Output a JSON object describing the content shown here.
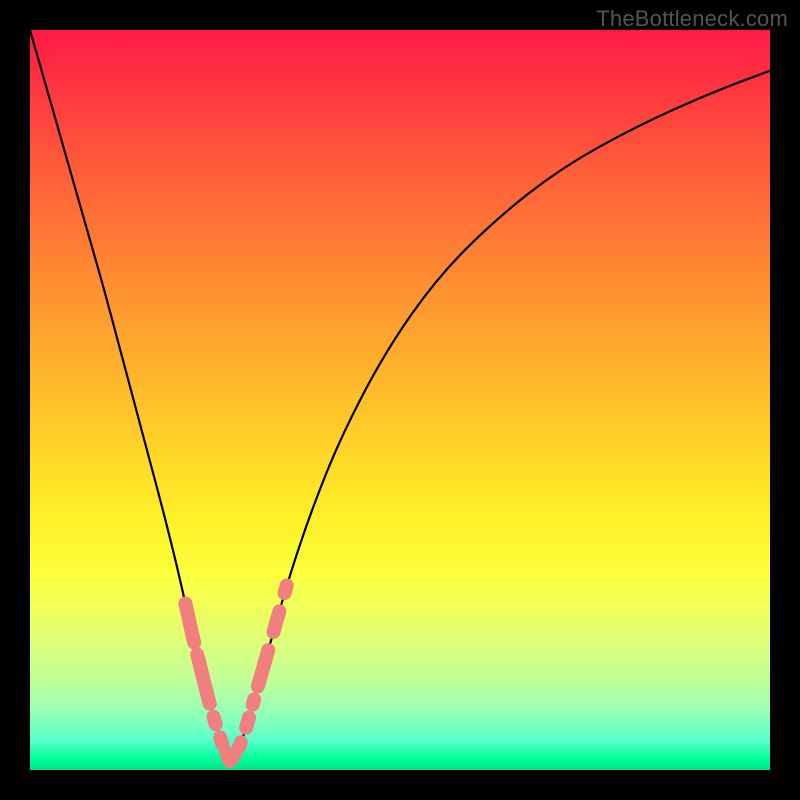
{
  "watermark": "TheBottleneck.com",
  "colors": {
    "frame": "#000000",
    "gradient_top": "#ff1a46",
    "gradient_bottom": "#00e088",
    "curve": "#000000",
    "marker_fill": "#f08080",
    "marker_stroke": "#e06868"
  },
  "chart_data": {
    "type": "line",
    "title": "",
    "xlabel": "",
    "ylabel": "",
    "xlim": [
      0,
      100
    ],
    "ylim": [
      0,
      100
    ],
    "minimum_x": 27,
    "series": [
      {
        "name": "bottleneck-curve",
        "x": [
          0,
          2,
          4,
          6,
          8,
          10,
          12,
          14,
          16,
          18,
          20,
          22,
          23,
          24,
          25,
          26,
          27,
          28,
          29,
          30,
          31,
          32,
          33,
          35,
          38,
          42,
          48,
          55,
          63,
          72,
          82,
          92,
          100
        ],
        "y": [
          100,
          93,
          86,
          79,
          72,
          65,
          57.5,
          50,
          42.5,
          35,
          27,
          18,
          14,
          10,
          6.5,
          3.5,
          1.2,
          2.5,
          5,
          8.5,
          12,
          15.5,
          19,
          26,
          35,
          45,
          56.5,
          66.5,
          74.5,
          81.5,
          87,
          91.5,
          94.5
        ]
      }
    ],
    "markers": [
      {
        "segment": "left",
        "x_start": 21.0,
        "x_end": 22.2
      },
      {
        "segment": "left",
        "x_start": 22.6,
        "x_end": 24.3
      },
      {
        "segment": "left",
        "x_start": 24.8,
        "x_end": 25.1
      },
      {
        "segment": "left",
        "x_start": 25.7,
        "x_end": 26.0
      },
      {
        "segment": "left",
        "x_start": 26.5,
        "x_end": 27.0
      },
      {
        "segment": "right",
        "x_start": 27.0,
        "x_end": 27.6
      },
      {
        "segment": "right",
        "x_start": 28.2,
        "x_end": 28.5
      },
      {
        "segment": "right",
        "x_start": 29.2,
        "x_end": 29.6
      },
      {
        "segment": "right",
        "x_start": 30.1,
        "x_end": 30.3
      },
      {
        "segment": "right",
        "x_start": 30.8,
        "x_end": 32.2
      },
      {
        "segment": "right",
        "x_start": 32.9,
        "x_end": 33.7
      },
      {
        "segment": "right",
        "x_start": 34.4,
        "x_end": 34.7
      }
    ]
  }
}
